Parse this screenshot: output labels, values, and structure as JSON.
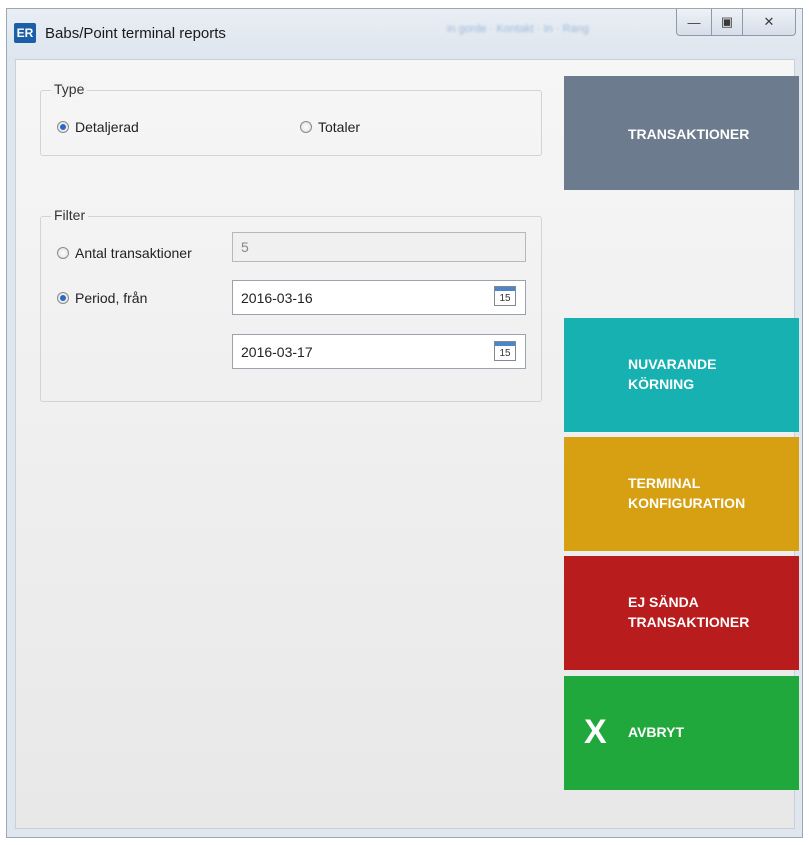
{
  "window": {
    "icon_text": "ER",
    "title": "Babs/Point terminal reports",
    "blurred_text": "in gorde · Kontakt · In · Rang"
  },
  "controls": {
    "minimize": "—",
    "maximize": "▣",
    "close": "✕"
  },
  "type_group": {
    "legend": "Type",
    "options": [
      {
        "label": "Detaljerad",
        "checked": true
      },
      {
        "label": "Totaler",
        "checked": false
      }
    ]
  },
  "filter_group": {
    "legend": "Filter",
    "antal_label": "Antal transaktioner",
    "antal_value": "5",
    "period_label": "Period, från",
    "date_from": "2016-03-16",
    "date_to": "2016-03-17",
    "calendar_day": "15"
  },
  "buttons": {
    "transaktioner": {
      "label": "TRANSAKTIONER",
      "color": "#6d7b8e"
    },
    "nuvarande": {
      "label": "NUVARANDE\nKÖRNING",
      "color": "#17b1b1"
    },
    "terminal": {
      "label": "TERMINAL\nKONFIGURATION",
      "color": "#d6a012"
    },
    "ej_sanda": {
      "label": "EJ SÄNDA\nTRANSAKTIONER",
      "color": "#b91c1c"
    },
    "avbryt": {
      "label": "AVBRYT",
      "icon": "X",
      "color": "#21a83c"
    }
  }
}
